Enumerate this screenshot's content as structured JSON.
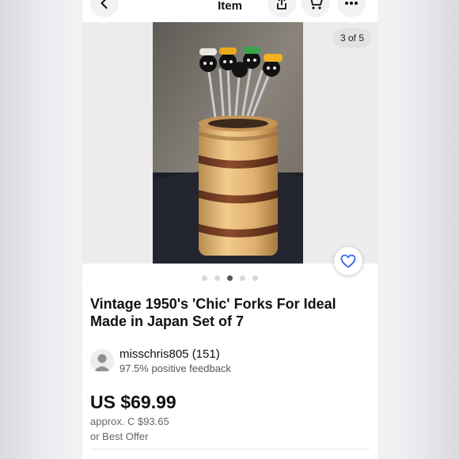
{
  "header": {
    "title": "Item",
    "icons": [
      "chevron-left-icon",
      "share-icon",
      "cart-icon",
      "more-icon"
    ]
  },
  "gallery": {
    "counter": "3 of 5",
    "current_index": 3,
    "total": 5,
    "image_description_icon": "product-photo"
  },
  "listing": {
    "title": "Vintage 1950's 'Chic' Forks For Ideal Made in Japan Set of 7"
  },
  "seller": {
    "name": "misschris805 (151)",
    "feedback": "97.5% positive feedback"
  },
  "price": {
    "main": "US $69.99",
    "approx": "approx. C $93.65",
    "offer": "or Best Offer"
  },
  "colors": {
    "accent": "#3665f3",
    "text": "#111111",
    "muted": "#666666"
  }
}
